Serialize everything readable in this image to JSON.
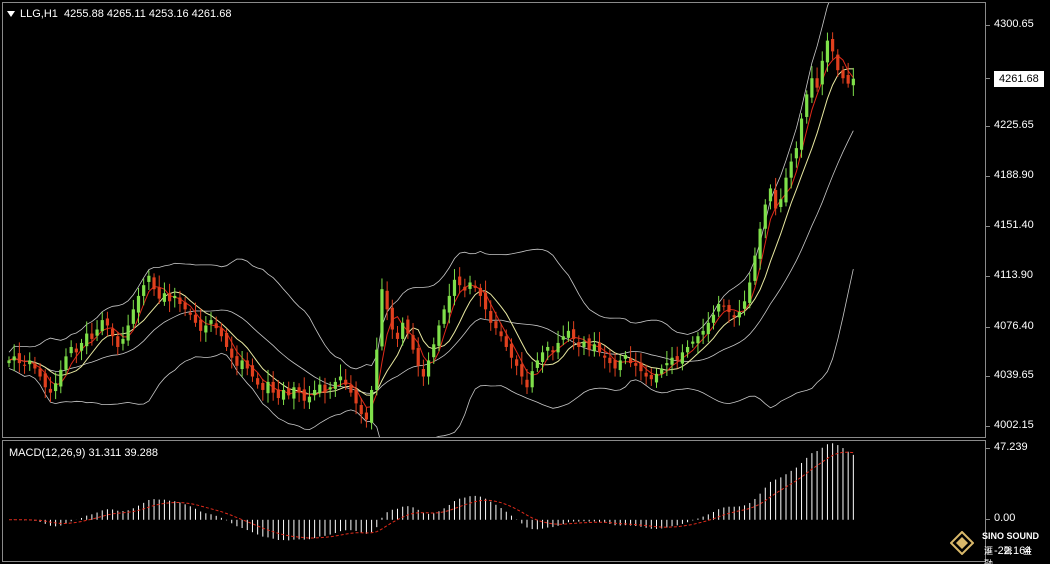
{
  "header": {
    "symbol": "LLG,H1",
    "ohlc": "4255.88 4265.11 4253.16 4261.68"
  },
  "price_axis": {
    "ticks": [
      "4300.65",
      "4261.68",
      "4225.65",
      "4188.90",
      "4151.40",
      "4113.90",
      "4076.40",
      "4039.65",
      "4002.15"
    ],
    "current_price": "4261.68"
  },
  "macd": {
    "label": "MACD(12,26,9) 31.311 39.288",
    "ticks": [
      "47.239",
      "0.00",
      "-22.164"
    ]
  },
  "watermark": {
    "brand": "SINO SOUND",
    "sub": "滙 聲 金 融"
  },
  "colors": {
    "background": "#000000",
    "bull_candle": "#7fe04a",
    "bear_candle": "#e0401e",
    "band_line": "#c8c8c8",
    "ma_line": "#e8e8a0",
    "fast_ma": "#e02a1a",
    "macd_hist": "#ffffff",
    "macd_signal": "#e02a1a"
  },
  "chart_data": {
    "type": "candlestick",
    "ylim": [
      3995,
      4318
    ],
    "closes": [
      4052,
      4055,
      4050,
      4048,
      4052,
      4046,
      4040,
      4032,
      4028,
      4035,
      4045,
      4055,
      4062,
      4058,
      4065,
      4072,
      4068,
      4075,
      4082,
      4078,
      4070,
      4062,
      4068,
      4078,
      4090,
      4100,
      4108,
      4115,
      4105,
      4098,
      4102,
      4096,
      4100,
      4094,
      4090,
      4086,
      4080,
      4074,
      4078,
      4082,
      4076,
      4070,
      4062,
      4054,
      4048,
      4052,
      4046,
      4040,
      4034,
      4030,
      4036,
      4028,
      4024,
      4030,
      4026,
      4032,
      4028,
      4022,
      4025,
      4030,
      4034,
      4028,
      4032,
      4036,
      4040,
      4034,
      4028,
      4020,
      4012,
      4008,
      4030,
      4060,
      4105,
      4090,
      4075,
      4068,
      4080,
      4072,
      4060,
      4048,
      4040,
      4052,
      4064,
      4078,
      4090,
      4100,
      4112,
      4108,
      4104,
      4110,
      4106,
      4100,
      4090,
      4080,
      4076,
      4070,
      4062,
      4054,
      4048,
      4040,
      4032,
      4044,
      4052,
      4058,
      4062,
      4058,
      4065,
      4070,
      4074,
      4068,
      4062,
      4066,
      4060,
      4064,
      4058,
      4054,
      4050,
      4046,
      4052,
      4056,
      4050,
      4048,
      4044,
      4040,
      4038,
      4042,
      4046,
      4050,
      4054,
      4052,
      4058,
      4062,
      4066,
      4070,
      4074,
      4080,
      4086,
      4094,
      4092,
      4088,
      4084,
      4088,
      4096,
      4110,
      4130,
      4150,
      4168,
      4180,
      4165,
      4172,
      4188,
      4200,
      4210,
      4232,
      4250,
      4262,
      4255,
      4275,
      4290,
      4282,
      4268,
      4262,
      4258,
      4261.68
    ]
  }
}
